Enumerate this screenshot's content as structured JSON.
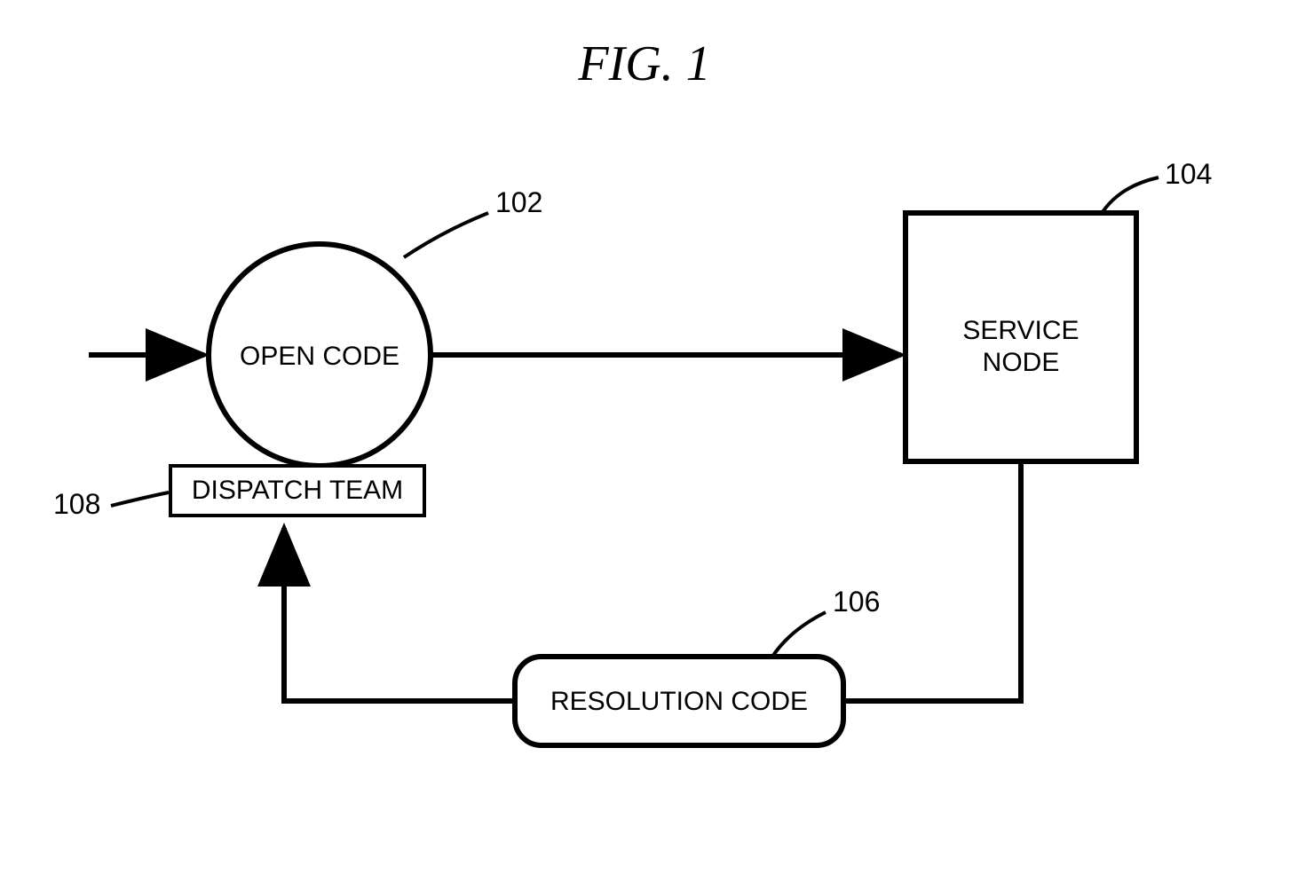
{
  "title": "FIG.  1",
  "nodes": {
    "open_code": {
      "label": "OPEN CODE",
      "ref": "102"
    },
    "service_node": {
      "line1": "SERVICE",
      "line2": "NODE",
      "ref": "104"
    },
    "resolution_code": {
      "label": "RESOLUTION CODE",
      "ref": "106"
    },
    "dispatch_team": {
      "label": "DISPATCH TEAM",
      "ref": "108"
    }
  }
}
